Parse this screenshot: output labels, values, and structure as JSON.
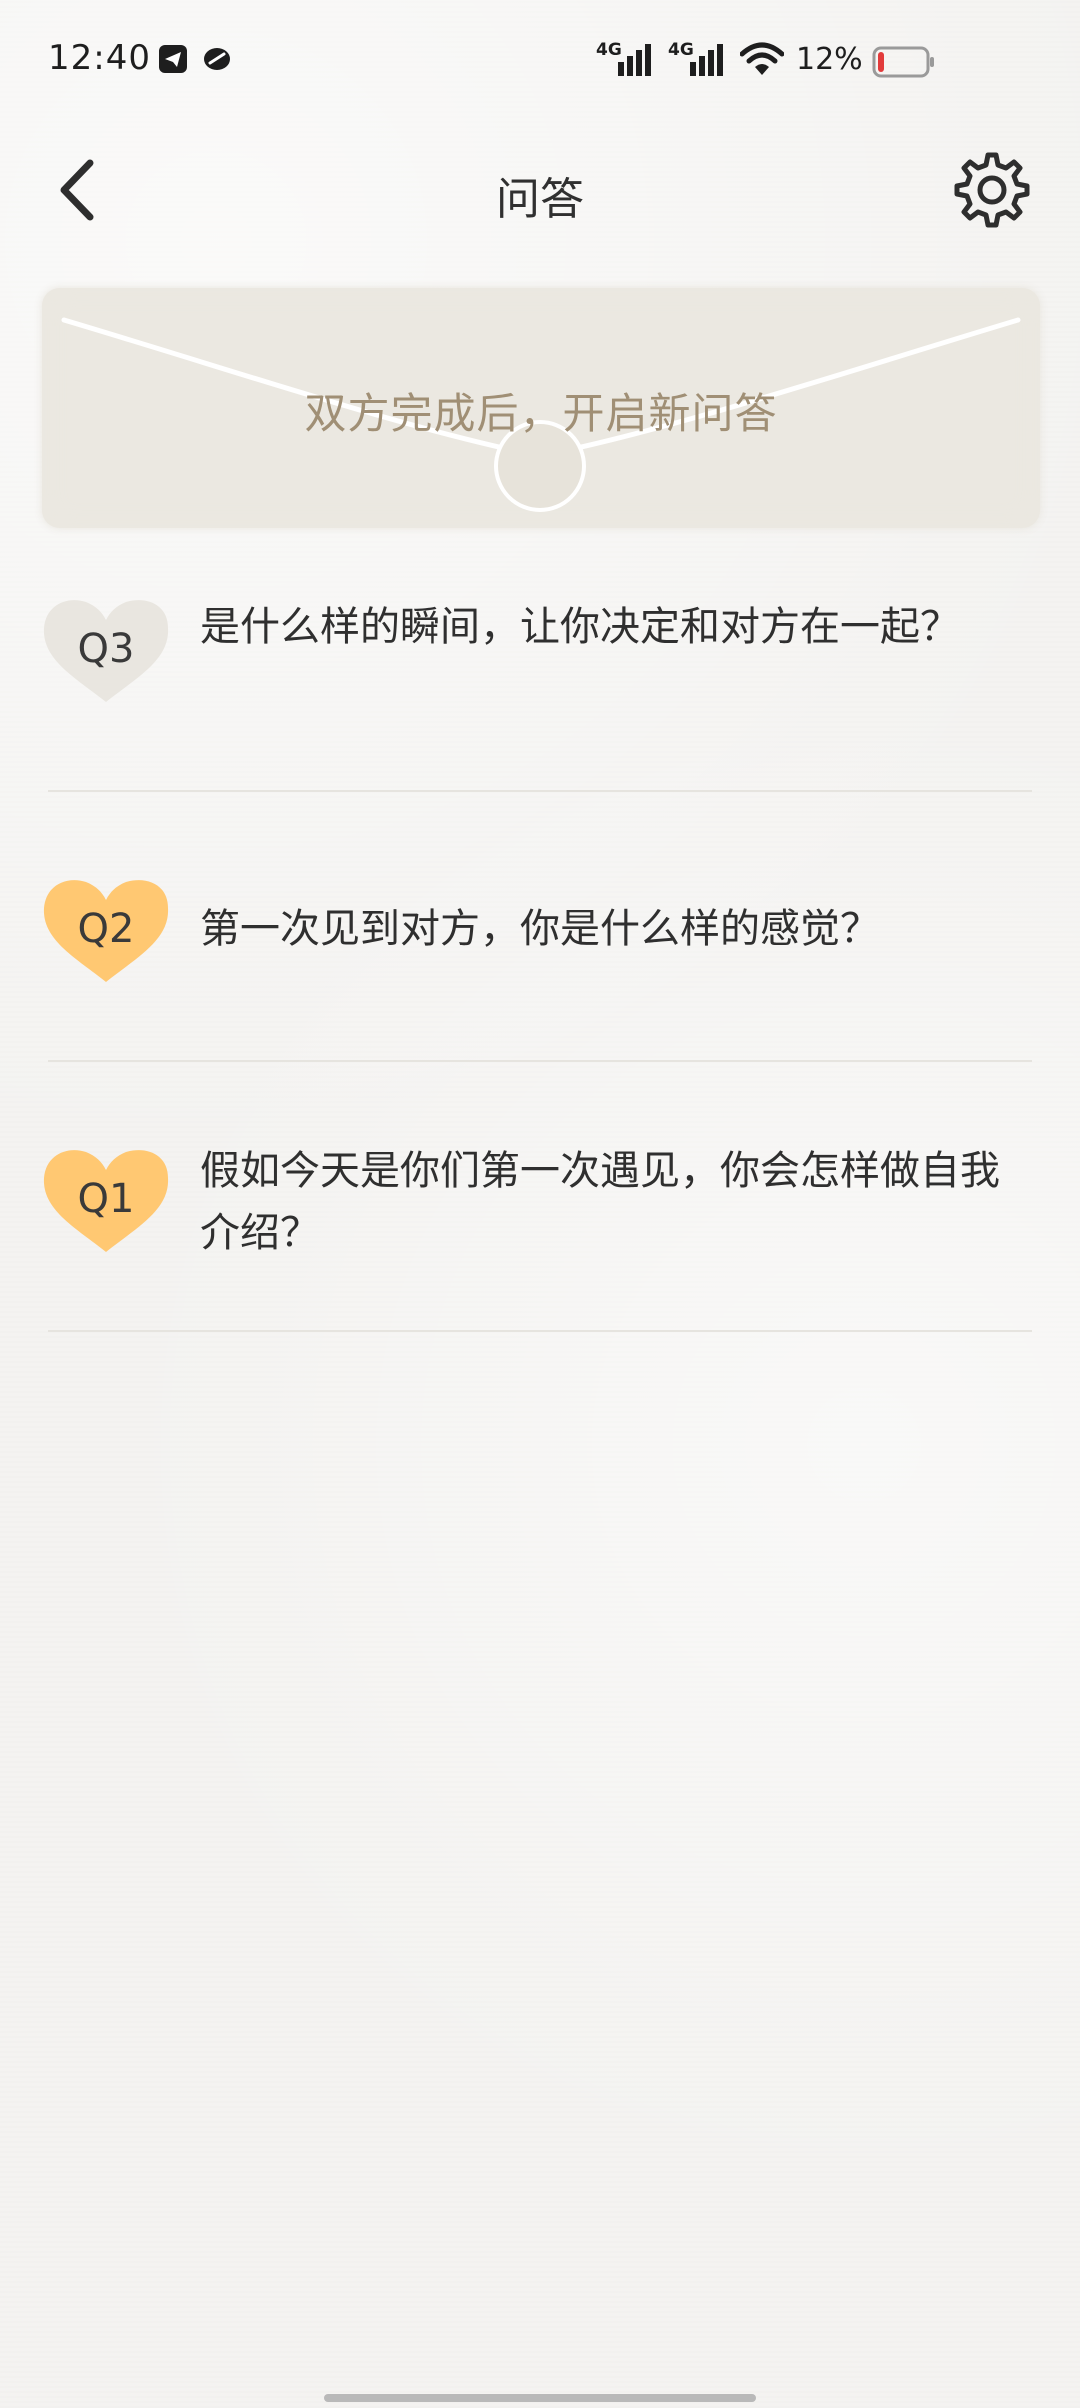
{
  "status_bar": {
    "time": "12:40",
    "battery": "12%",
    "network_1": "4G",
    "network_2": "4G",
    "left_icons": [
      "telegram-icon",
      "app-icon"
    ],
    "right_icons": [
      "signal-icon",
      "signal-icon",
      "wifi-icon",
      "battery-icon"
    ],
    "battery_level": 0.12,
    "battery_color": "#e23b3b"
  },
  "header": {
    "title": "问答",
    "back_icon": "chevron-left-icon",
    "settings_icon": "gear-icon"
  },
  "banner": {
    "text": "双方完成后，开启新问答"
  },
  "questions": [
    {
      "label": "Q3",
      "text": "是什么样的瞬间，让你决定和对方在一起？",
      "status": "pending",
      "badge_color": "#e9e6e0"
    },
    {
      "label": "Q2",
      "text": "第一次见到对方，你是什么样的感觉？",
      "status": "done",
      "badge_color": "#ffc872"
    },
    {
      "label": "Q1",
      "text": "假如今天是你们第一次遇见，你会怎样做自我介绍？",
      "status": "done",
      "badge_color": "#ffc872"
    }
  ]
}
